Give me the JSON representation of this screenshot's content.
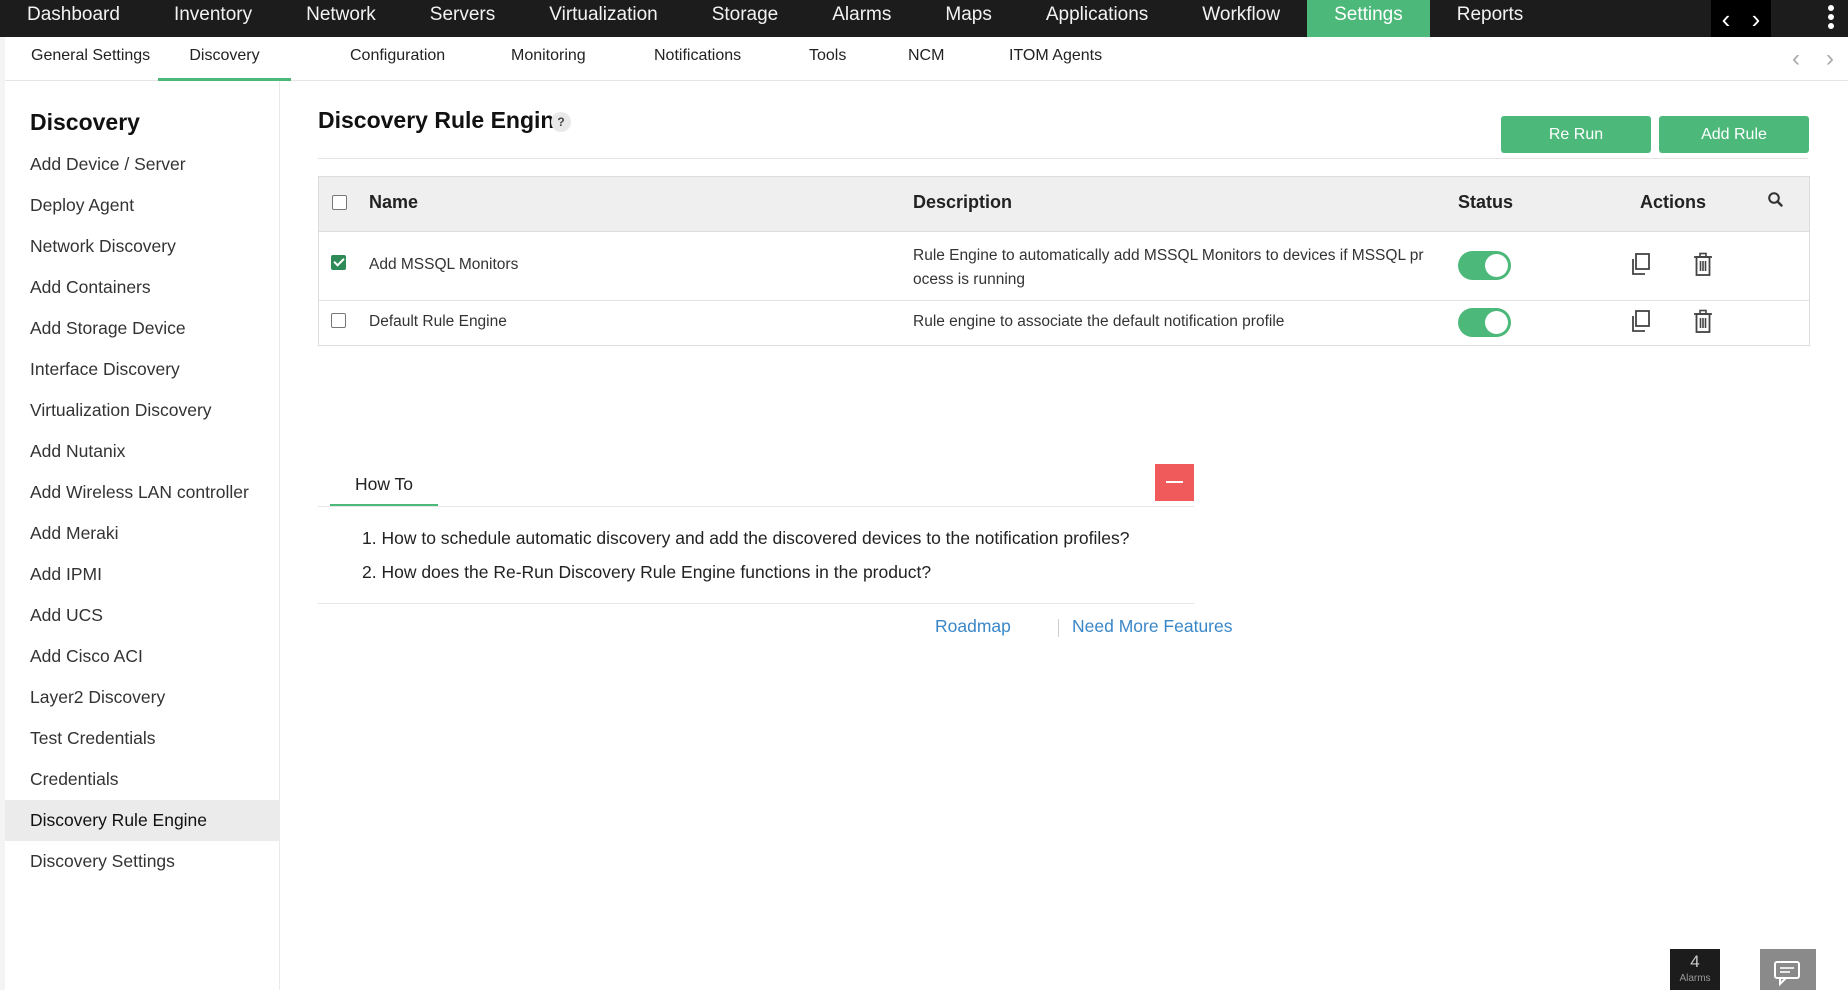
{
  "top_nav": {
    "items": [
      "Dashboard",
      "Inventory",
      "Network",
      "Servers",
      "Virtualization",
      "Storage",
      "Alarms",
      "Maps",
      "Applications",
      "Workflow",
      "Settings",
      "Reports"
    ],
    "active": "Settings"
  },
  "sub_nav": {
    "items": [
      "General Settings",
      "Discovery",
      "Configuration",
      "Monitoring",
      "Notifications",
      "Tools",
      "NCM",
      "ITOM Agents"
    ],
    "active": "Discovery"
  },
  "sidebar": {
    "title": "Discovery",
    "items": [
      "Add Device / Server",
      "Deploy Agent",
      "Network Discovery",
      "Add Containers",
      "Add Storage Device",
      "Interface Discovery",
      "Virtualization Discovery",
      "Add Nutanix",
      "Add Wireless LAN controller",
      "Add Meraki",
      "Add IPMI",
      "Add UCS",
      "Add Cisco ACI",
      "Layer2 Discovery",
      "Test Credentials",
      "Credentials",
      "Discovery Rule Engine",
      "Discovery Settings"
    ],
    "active": "Discovery Rule Engine"
  },
  "main": {
    "title": "Discovery Rule Engine",
    "help": "?",
    "buttons": {
      "rerun": "Re Run",
      "add_rule": "Add Rule"
    },
    "table": {
      "columns": [
        "Name",
        "Description",
        "Status",
        "Actions"
      ],
      "rows": [
        {
          "name": "Add MSSQL Monitors",
          "description_lines": [
            "Rule Engine to automatically add MSSQL Monitors to devices if MSSQL pr",
            "ocess is running"
          ],
          "checked": true,
          "status": "on"
        },
        {
          "name": "Default Rule Engine",
          "description_lines": [
            "Rule engine to associate the default notification profile"
          ],
          "checked": false,
          "status": "on"
        }
      ]
    }
  },
  "howto": {
    "tab": "How To",
    "questions": [
      "1. How to schedule automatic discovery and add the discovered devices to the notification profiles?",
      "2. How does the Re-Run Discovery Rule Engine functions in the product?"
    ],
    "links": {
      "roadmap": "Roadmap",
      "features": "Need More Features"
    }
  },
  "alarms": {
    "count": "4",
    "label": "Alarms"
  },
  "colors": {
    "accent": "#4cb87a",
    "collapse": "#f05a5a",
    "link": "#3a87c8",
    "nav_bg": "#1c1c1c"
  }
}
